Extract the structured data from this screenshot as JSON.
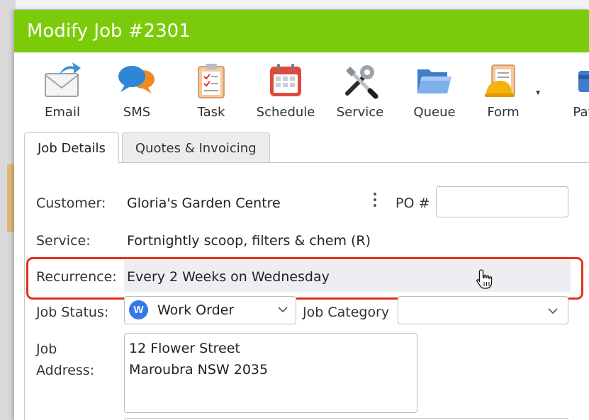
{
  "window": {
    "title": "Modify Job #2301"
  },
  "toolbar": {
    "items": [
      {
        "label": "Email",
        "icon": "email-icon"
      },
      {
        "label": "SMS",
        "icon": "sms-icon"
      },
      {
        "label": "Task",
        "icon": "task-icon"
      },
      {
        "label": "Schedule",
        "icon": "schedule-icon"
      },
      {
        "label": "Service",
        "icon": "service-icon"
      },
      {
        "label": "Queue",
        "icon": "queue-icon"
      },
      {
        "label": "Form",
        "icon": "form-icon"
      },
      {
        "label": "Payr",
        "icon": "payment-icon"
      }
    ]
  },
  "tabs": [
    {
      "label": "Job Details",
      "active": true
    },
    {
      "label": "Quotes & Invoicing",
      "active": false
    }
  ],
  "form": {
    "customer_label": "Customer:",
    "customer_value": "Gloria's Garden Centre",
    "po_label": "PO #",
    "po_value": "",
    "service_label": "Service:",
    "service_value": "Fortnightly scoop, filters & chem (R)",
    "recurrence_label": "Recurrence:",
    "recurrence_value": "Every 2 Weeks on Wednesday",
    "job_status_label": "Job Status:",
    "job_status_badge": "W",
    "job_status_value": "Work Order",
    "job_category_label": "Job Category",
    "job_category_value": "",
    "job_address_label_line1": "Job",
    "job_address_label_line2": "Address:",
    "job_address_line1": "12 Flower Street",
    "job_address_line2": "Maroubra NSW 2035"
  },
  "colors": {
    "titlebar": "#7bcb0a",
    "highlight": "#e0311d",
    "status_badge": "#3478e8"
  }
}
